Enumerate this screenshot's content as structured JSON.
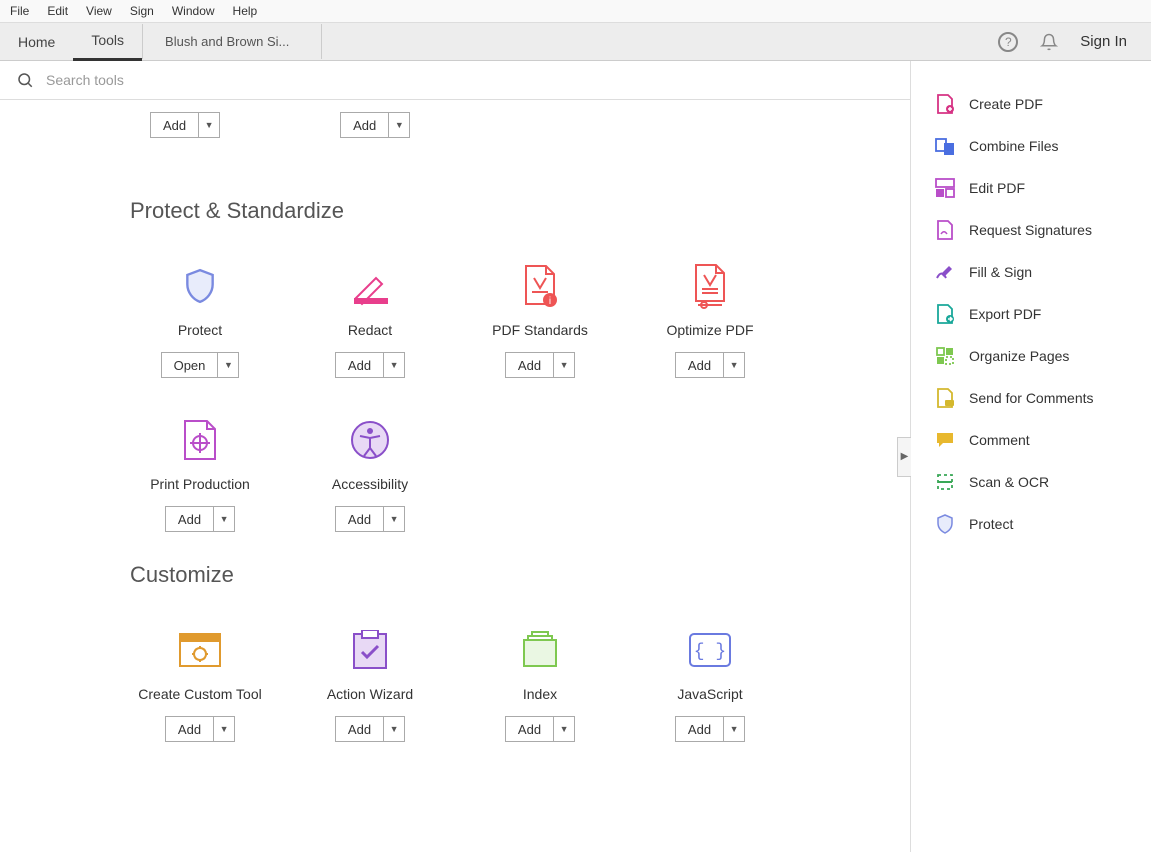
{
  "menu": {
    "items": [
      "File",
      "Edit",
      "View",
      "Sign",
      "Window",
      "Help"
    ]
  },
  "tabs": {
    "home": "Home",
    "tools": "Tools",
    "doc": "Blush and Brown Si..."
  },
  "header": {
    "signin": "Sign In"
  },
  "search": {
    "placeholder": "Search tools"
  },
  "orphan": {
    "btn0": "Add",
    "btn1": "Add"
  },
  "sections": {
    "protect": {
      "title": "Protect & Standardize",
      "tools": [
        {
          "label": "Protect",
          "action": "Open"
        },
        {
          "label": "Redact",
          "action": "Add"
        },
        {
          "label": "PDF Standards",
          "action": "Add"
        },
        {
          "label": "Optimize PDF",
          "action": "Add"
        },
        {
          "label": "Print Production",
          "action": "Add"
        },
        {
          "label": "Accessibility",
          "action": "Add"
        }
      ]
    },
    "customize": {
      "title": "Customize",
      "tools": [
        {
          "label": "Create Custom Tool",
          "action": "Add"
        },
        {
          "label": "Action Wizard",
          "action": "Add"
        },
        {
          "label": "Index",
          "action": "Add"
        },
        {
          "label": "JavaScript",
          "action": "Add"
        }
      ]
    }
  },
  "sidebar": {
    "items": [
      {
        "label": "Create PDF"
      },
      {
        "label": "Combine Files"
      },
      {
        "label": "Edit PDF"
      },
      {
        "label": "Request Signatures"
      },
      {
        "label": "Fill & Sign"
      },
      {
        "label": "Export PDF"
      },
      {
        "label": "Organize Pages"
      },
      {
        "label": "Send for Comments"
      },
      {
        "label": "Comment"
      },
      {
        "label": "Scan & OCR"
      },
      {
        "label": "Protect"
      }
    ]
  }
}
